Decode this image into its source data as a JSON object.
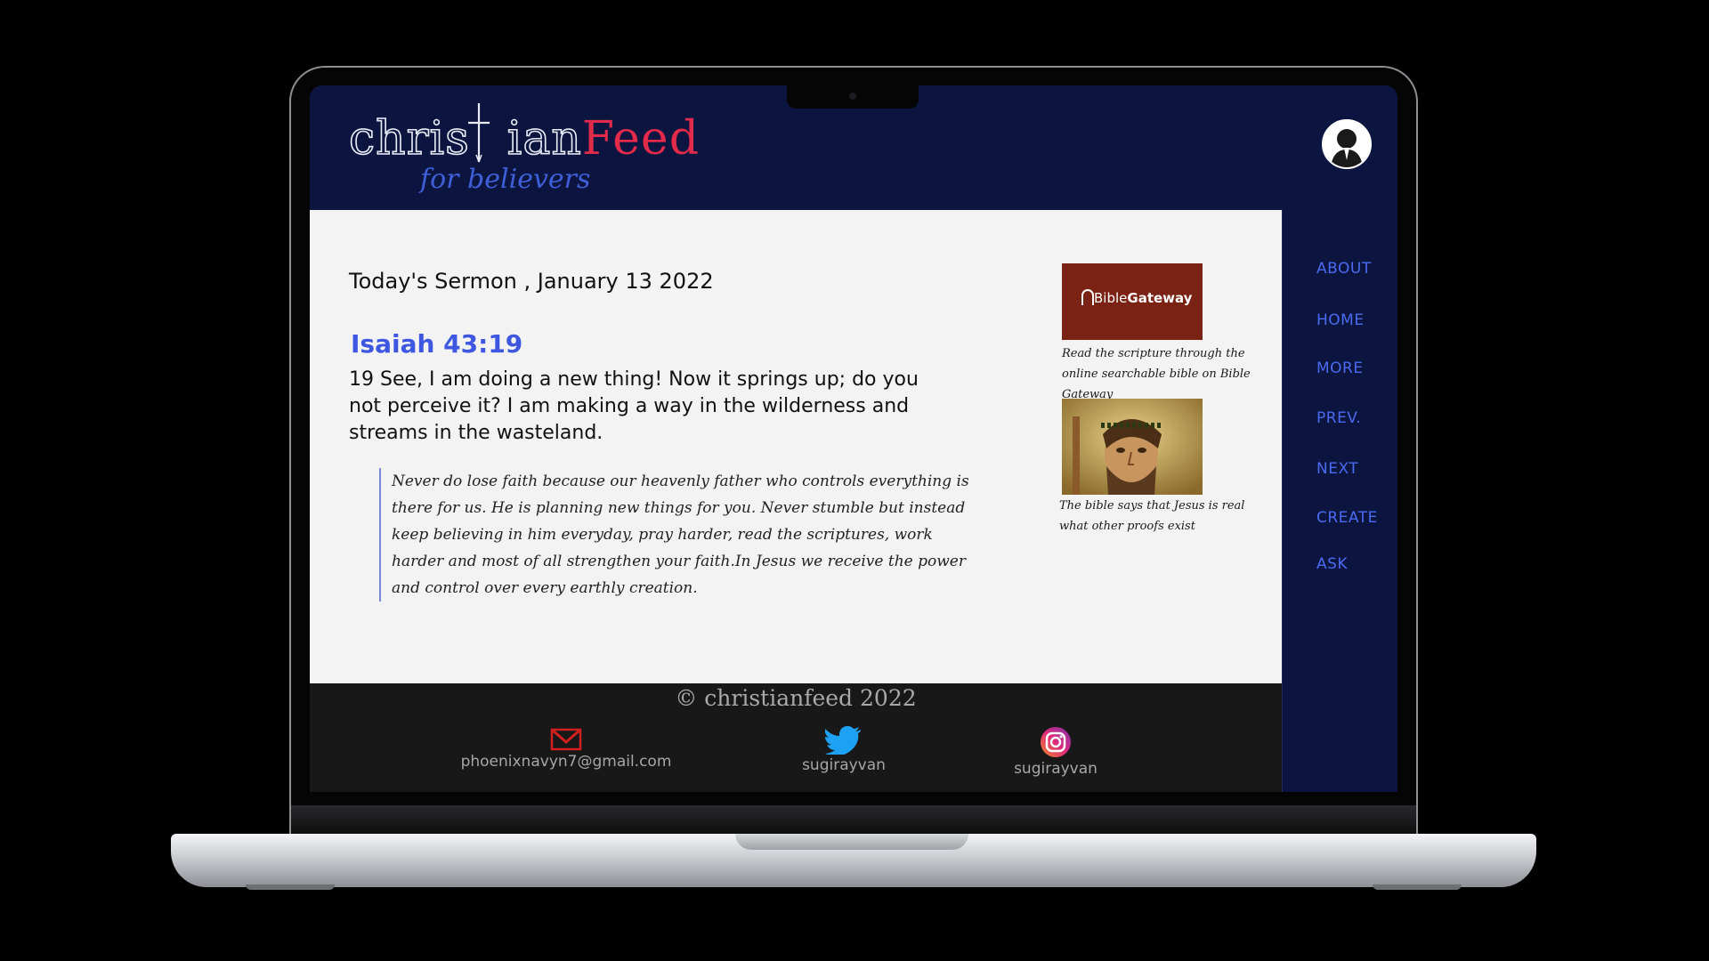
{
  "brand": {
    "name_part1": "chris",
    "name_part2": "ian",
    "name_part3": "Feed",
    "tagline": "for believers"
  },
  "sermon": {
    "title": "Today's Sermon , January 13  2022",
    "reference": "Isaiah 43:19",
    "verse": "19 See, I am doing a new thing! Now it springs up; do you not perceive it? I am making a way in the wilderness and streams in the wasteland.",
    "reflection": "Never do lose faith because our heavenly father who controls everything is there for us. He is planning new things for you. Never stumble but instead keep believing in him everyday, pray harder, read the scriptures, work harder and most of all strengthen your faith.In Jesus we receive the power and control over every earthly creation."
  },
  "sidebar": {
    "bible_gateway": {
      "label_part1": "Bible",
      "label_part2": "Gateway",
      "caption": "Read the scripture through the online searchable bible on Bible Gateway"
    },
    "jesus_image": {
      "caption": "The bible says that Jesus is real what other proofs exist"
    }
  },
  "nav": {
    "items": [
      {
        "label": "ABOUT"
      },
      {
        "label": "HOME"
      },
      {
        "label": "MORE"
      },
      {
        "label": "PREV."
      },
      {
        "label": "NEXT"
      },
      {
        "label": "CREATE"
      },
      {
        "label": "ASK"
      }
    ]
  },
  "footer": {
    "copyright": "© christianfeed 2022",
    "email": "phoenixnavyn7@gmail.com",
    "twitter": "sugirayvan",
    "instagram": "sugirayvan"
  },
  "colors": {
    "header_bg": "#0c1540",
    "accent_blue": "#3e57e0",
    "brand_red": "#e22a4a",
    "bible_gateway_bg": "#7a2213",
    "footer_bg": "#181818"
  },
  "icons": [
    "user-avatar-icon",
    "gmail-icon",
    "twitter-icon",
    "instagram-icon",
    "bible-gateway-logo"
  ]
}
